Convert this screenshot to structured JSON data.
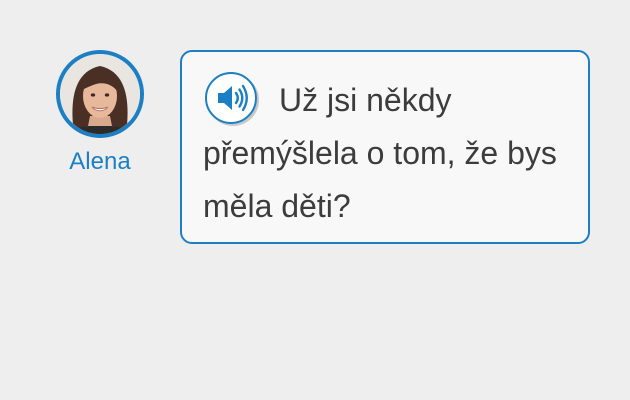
{
  "speaker": {
    "name": "Alena",
    "avatar_icon": "woman-portrait-avatar"
  },
  "message": {
    "text": "Už jsi někdy přemýšlela o tom, že bys měla děti?",
    "audio_icon": "speaker-volume-icon"
  },
  "colors": {
    "accent": "#1c7fc4",
    "background": "#eeeeee",
    "bubble_fill": "#f8f8f8",
    "text": "#3c3c3c"
  }
}
